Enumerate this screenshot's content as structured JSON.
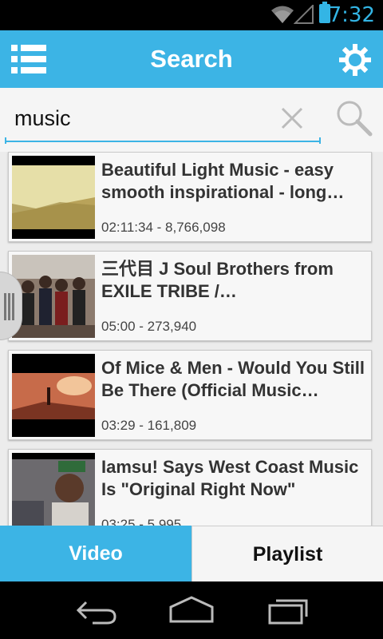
{
  "status_bar": {
    "time": "7:32",
    "icons": [
      "wifi-icon",
      "signal-icon",
      "battery-icon"
    ]
  },
  "action_bar": {
    "title": "Search",
    "left_icon": "list-menu-icon",
    "right_icon": "gear-icon"
  },
  "search": {
    "value": "music",
    "clear_icon": "close-icon",
    "search_icon": "search-icon"
  },
  "results": [
    {
      "title": "Beautiful Light Music - easy smooth inspirational - long…",
      "meta": "02:11:34 - 8,766,098"
    },
    {
      "title": "三代目 J Soul Brothers from EXILE TRIBE /…",
      "meta": "05:00 - 273,940"
    },
    {
      "title": "Of Mice & Men - Would You Still Be There (Official Music…",
      "meta": "03:29 - 161,809"
    },
    {
      "title": "Iamsu! Says West Coast Music Is \"Original Right Now\"",
      "meta": "03:25 - 5,995"
    }
  ],
  "tabs": [
    {
      "label": "Video",
      "selected": true
    },
    {
      "label": "Playlist",
      "selected": false
    }
  ],
  "nav_bar": {
    "icons": [
      "back-icon",
      "home-icon",
      "recents-icon"
    ]
  },
  "colors": {
    "accent": "#3cb4e5",
    "status_text": "#33b5e5"
  }
}
